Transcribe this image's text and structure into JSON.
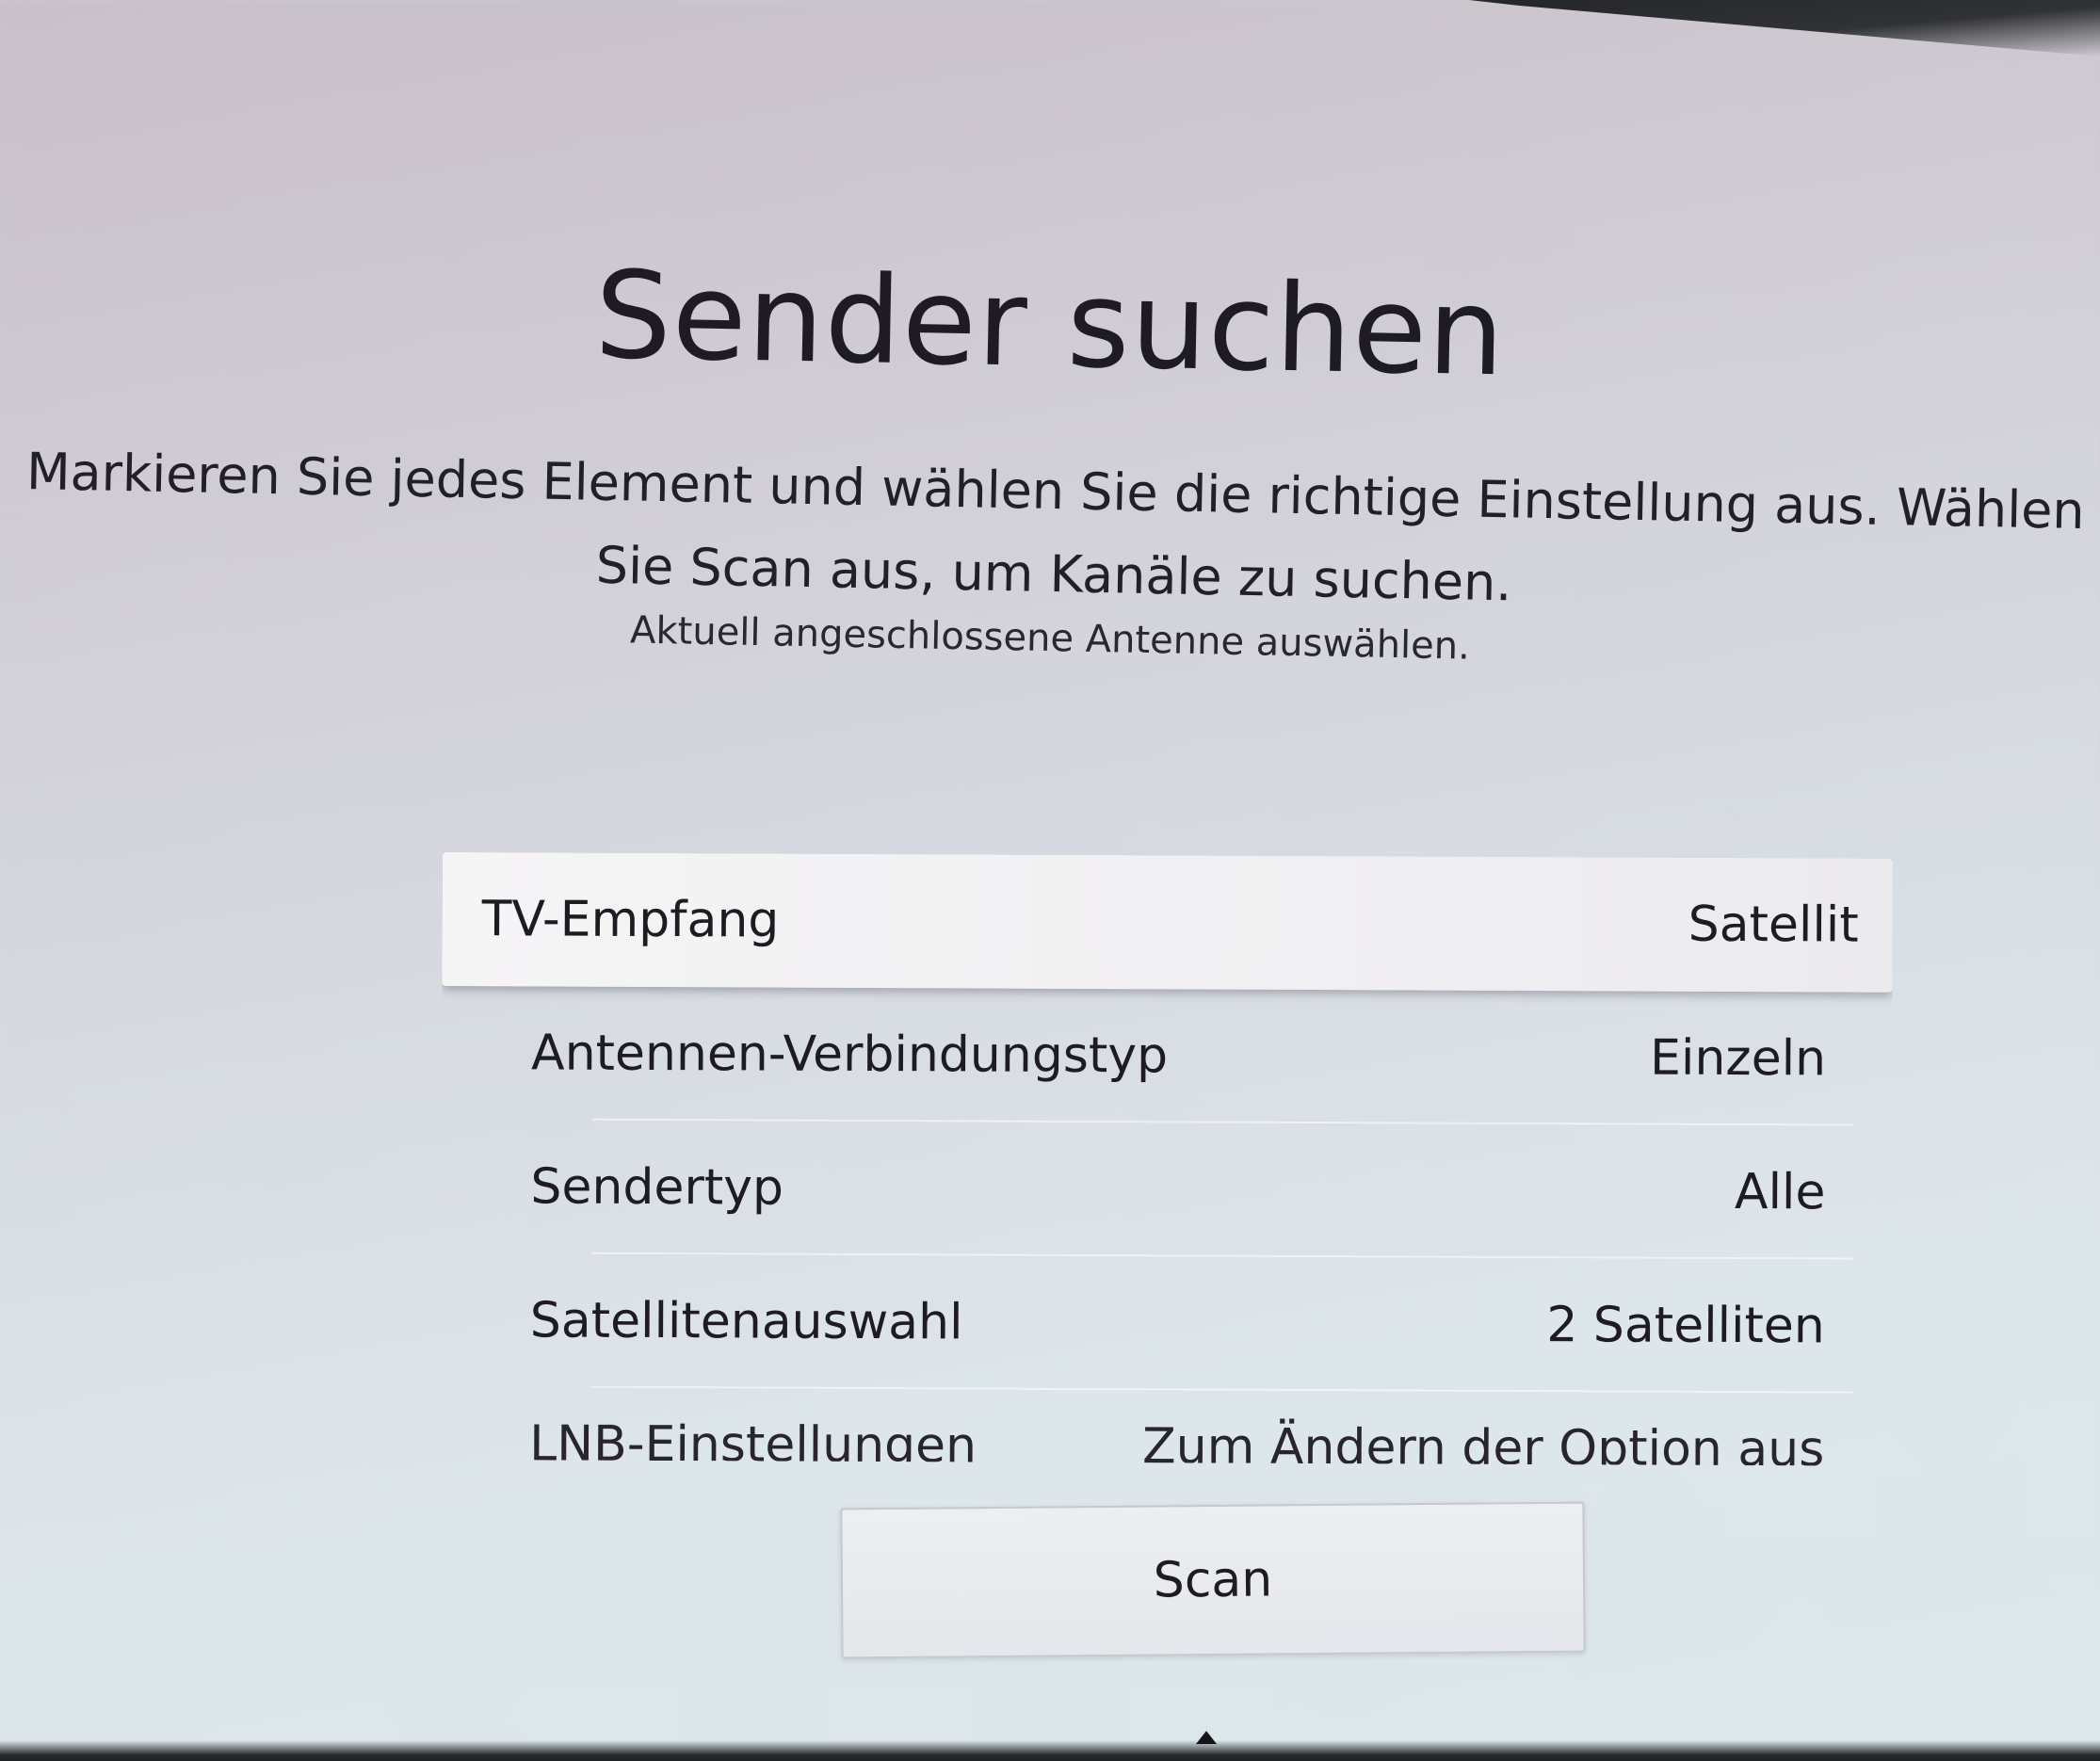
{
  "screen": {
    "title": "Sender suchen",
    "description": "Markieren Sie jedes Element und wählen Sie die richtige Einstellung aus. Wählen Sie Scan aus, um Kanäle zu suchen.",
    "hint": "Aktuell angeschlossene Antenne auswählen."
  },
  "menu": {
    "items": [
      {
        "label": "TV-Empfang",
        "value": "Satellit"
      },
      {
        "label": "Antennen-Verbindungstyp",
        "value": "Einzeln"
      },
      {
        "label": "Sendertyp",
        "value": "Alle"
      },
      {
        "label": "Satellitenauswahl",
        "value": "2 Satelliten"
      },
      {
        "label": "LNB-Einstellungen",
        "value": "Zum Ändern der Option aus"
      }
    ]
  },
  "scan_button": {
    "label": "Scan"
  },
  "icons": {
    "scroll_indicator": "chevron-up-icon"
  }
}
